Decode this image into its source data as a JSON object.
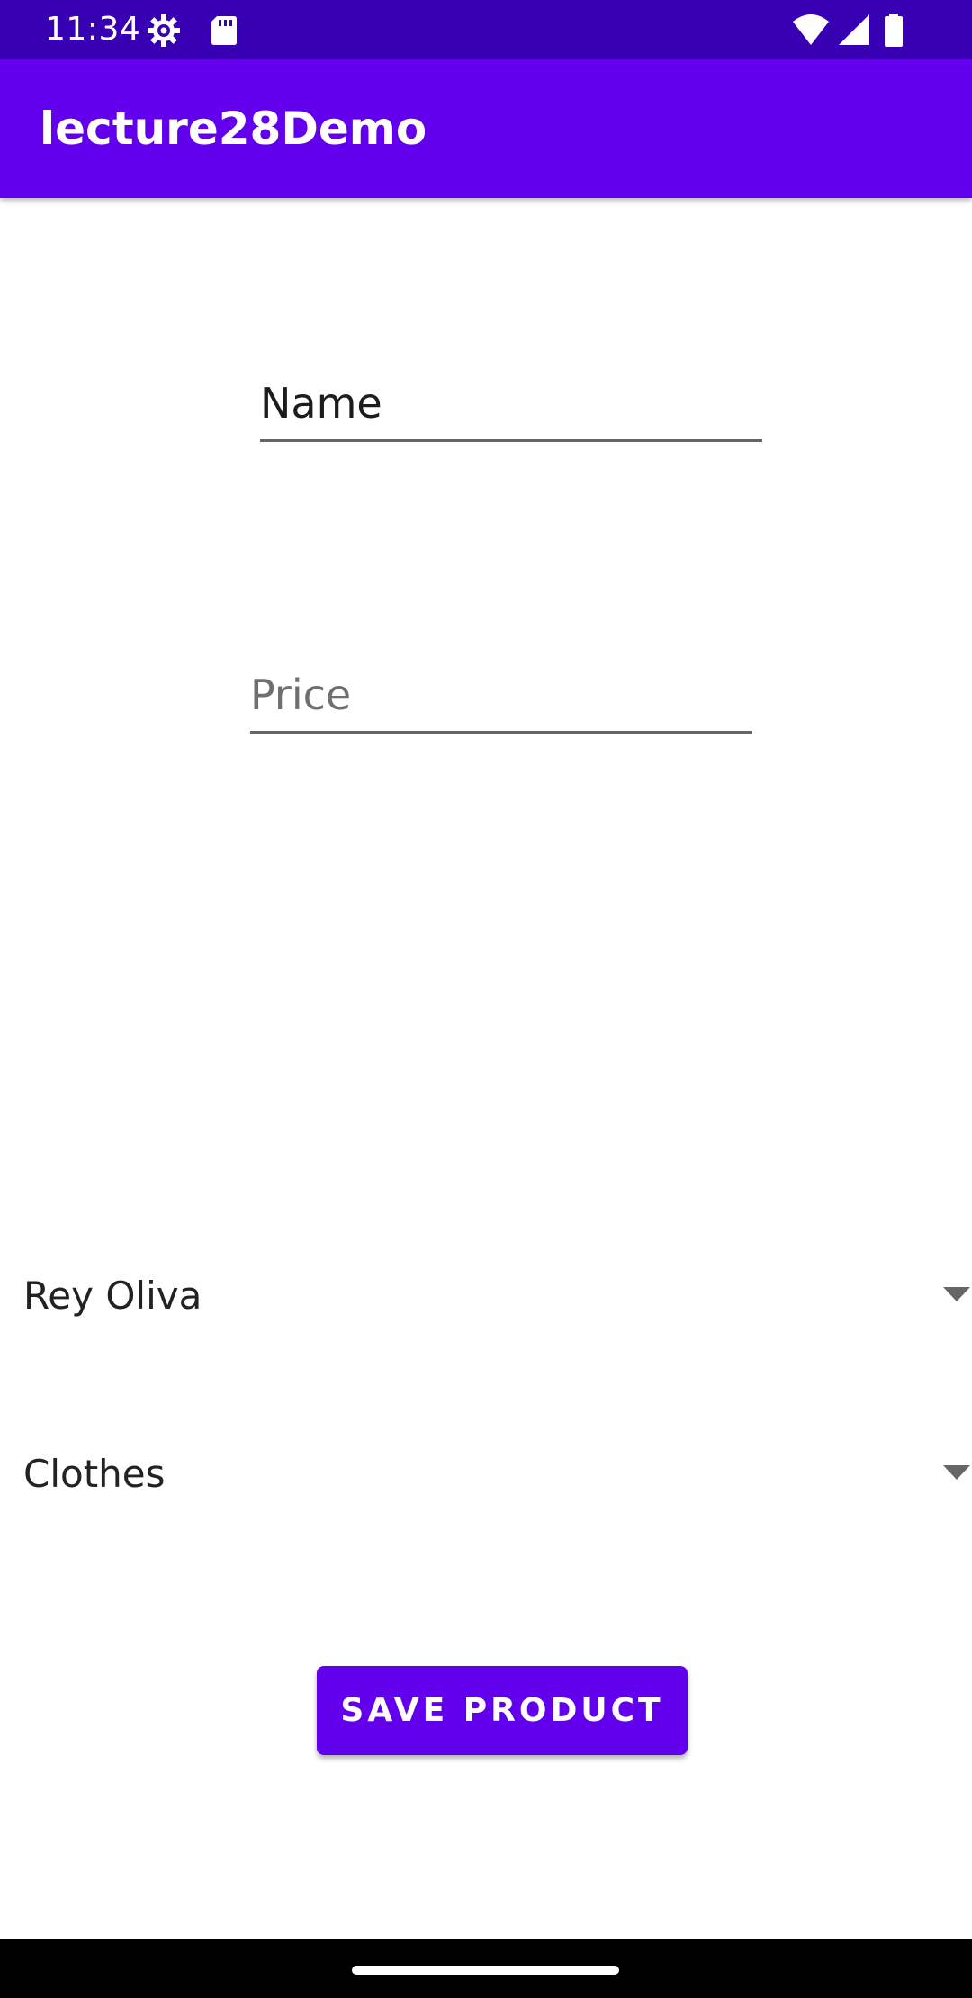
{
  "status_bar": {
    "time": "11:34",
    "icons": [
      "settings-gear-icon",
      "sd-card-icon",
      "wifi-icon",
      "cellular-signal-icon",
      "battery-icon"
    ]
  },
  "app_bar": {
    "title": "lecture28Demo"
  },
  "form": {
    "name_field": {
      "value": "Name",
      "placeholder": ""
    },
    "price_field": {
      "value": "",
      "placeholder": "Price"
    },
    "user_spinner": {
      "selected": "Rey Oliva"
    },
    "category_spinner": {
      "selected": "Clothes"
    },
    "save_button_label": "SAVE PRODUCT"
  },
  "colors": {
    "status_bar": "#3700b3",
    "primary": "#6200ee",
    "text": "#222222",
    "hint": "#6f6f6f",
    "nav_bar": "#000000"
  }
}
